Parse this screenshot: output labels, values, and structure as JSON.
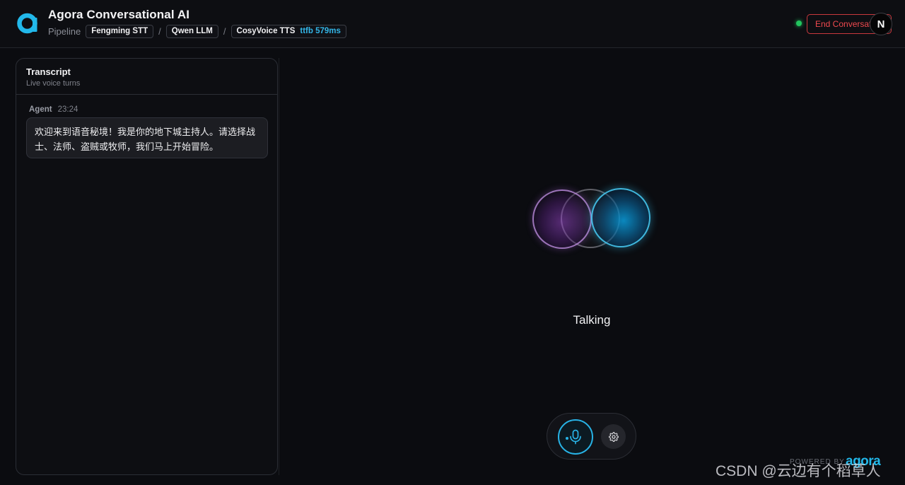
{
  "header": {
    "title": "Agora Conversational AI",
    "pipeline_label": "Pipeline",
    "stt": "Fengming STT",
    "llm": "Qwen LLM",
    "tts": "CosyVoice TTS",
    "ttfb": "ttfb 579ms",
    "end_button": "End Conversation",
    "avatar_letter": "N",
    "status_color": "#22c55e"
  },
  "transcript": {
    "title": "Transcript",
    "subtitle": "Live voice turns",
    "messages": [
      {
        "author": "Agent",
        "time": "23:24",
        "text": "欢迎来到语音秘境！我是你的地下城主持人。请选择战士、法师、盗贼或牧师，我们马上开始冒险。"
      }
    ]
  },
  "agent": {
    "state": "Talking"
  },
  "controls": {
    "mic_icon": "microphone-icon",
    "settings_icon": "gear-icon",
    "accent": "#28b3e6"
  },
  "footer": {
    "powered_by": "POWERED BY",
    "brand": "agora"
  },
  "watermark": "CSDN @云边有个稻草人"
}
